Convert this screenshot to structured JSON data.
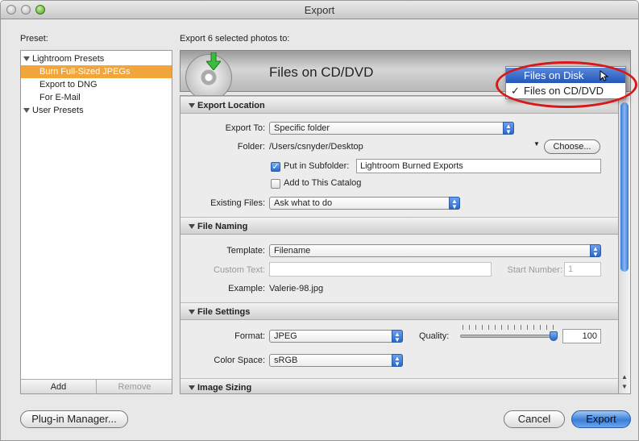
{
  "window": {
    "title": "Export"
  },
  "preset": {
    "label": "Preset:",
    "groups": [
      {
        "name": "Lightroom Presets",
        "items": [
          "Burn Full-Sized JPEGs",
          "Export to DNG",
          "For E-Mail"
        ]
      },
      {
        "name": "User Presets",
        "items": []
      }
    ],
    "add_label": "Add",
    "remove_label": "Remove"
  },
  "export_to_label": "Export 6 selected photos to:",
  "banner": {
    "title": "Files on CD/DVD"
  },
  "destination_menu": {
    "items": [
      "Files on Disk",
      "Files on CD/DVD"
    ],
    "checked_mark": "✓"
  },
  "sections": {
    "export_location": {
      "title": "Export Location",
      "export_to_label": "Export To:",
      "export_to_value": "Specific folder",
      "folder_label": "Folder:",
      "folder_value": "/Users/csnyder/Desktop",
      "choose_label": "Choose...",
      "subfolder_label": "Put in Subfolder:",
      "subfolder_value": "Lightroom Burned Exports",
      "add_catalog_label": "Add to This Catalog",
      "existing_files_label": "Existing Files:",
      "existing_files_value": "Ask what to do"
    },
    "file_naming": {
      "title": "File Naming",
      "template_label": "Template:",
      "template_value": "Filename",
      "custom_text_label": "Custom Text:",
      "start_number_label": "Start Number:",
      "start_number_value": "1",
      "example_label": "Example:",
      "example_value": "Valerie-98.jpg"
    },
    "file_settings": {
      "title": "File Settings",
      "format_label": "Format:",
      "format_value": "JPEG",
      "quality_label": "Quality:",
      "quality_value": "100",
      "quality_fraction": 1.0,
      "color_space_label": "Color Space:",
      "color_space_value": "sRGB"
    },
    "image_sizing": {
      "title": "Image Sizing"
    }
  },
  "footer": {
    "plugin_manager_label": "Plug-in Manager...",
    "cancel_label": "Cancel",
    "export_label": "Export"
  },
  "colors": {
    "selection_orange": "#f1a53a",
    "accent_blue": "#2a68cc",
    "annotation_red": "#d81818"
  }
}
